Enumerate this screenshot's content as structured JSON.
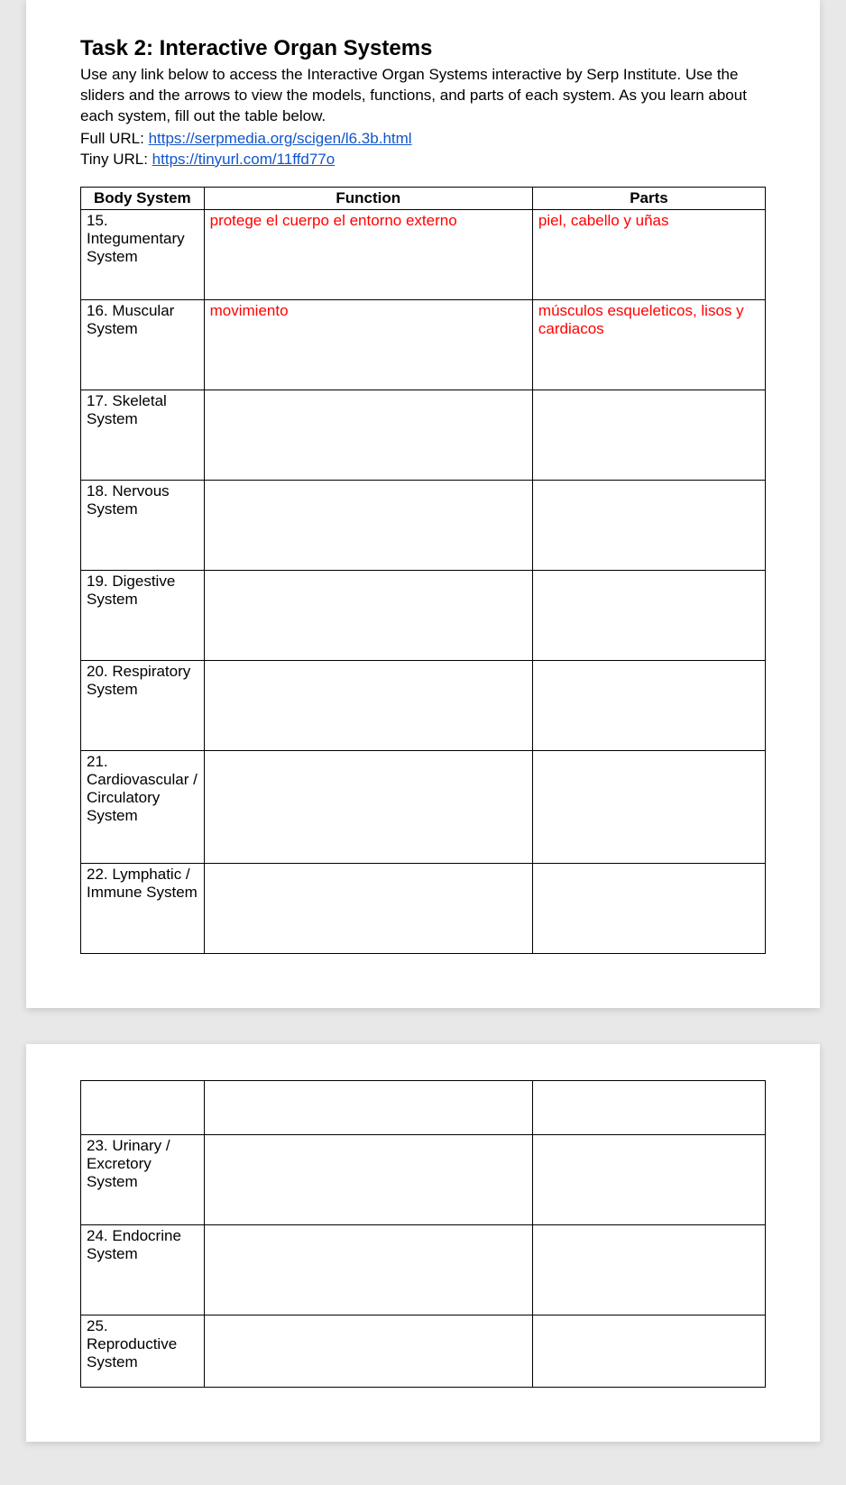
{
  "title": "Task 2: Interactive Organ Systems",
  "intro": "Use any link below to access the Interactive Organ Systems interactive by Serp Institute. Use the sliders and the arrows to view the models, functions, and parts of each system. As you learn about each system, fill out the table below.",
  "full_url_label": "Full URL: ",
  "full_url_text": "https://serpmedia.org/scigen/l6.3b.html",
  "tiny_url_label": "Tiny URL: ",
  "tiny_url_text": "https://tinyurl.com/11ffd77o",
  "headers": {
    "col1": "Body System",
    "col2": "Function",
    "col3": "Parts"
  },
  "rows_page1": [
    {
      "system": "15. Integumentary System",
      "function": "protege el cuerpo el entorno externo",
      "parts": "piel, cabello y uñas"
    },
    {
      "system": "16. Muscular System",
      "function": "movimiento",
      "parts": "músculos esqueleticos, lisos y cardiacos"
    },
    {
      "system": "17. Skeletal System",
      "function": "",
      "parts": ""
    },
    {
      "system": "18. Nervous System",
      "function": "",
      "parts": ""
    },
    {
      "system": "19. Digestive System",
      "function": "",
      "parts": ""
    },
    {
      "system": "20. Respiratory System",
      "function": "",
      "parts": ""
    },
    {
      "system": "21. Cardiovascular / Circulatory System",
      "function": "",
      "parts": ""
    },
    {
      "system": "22. Lymphatic / Immune System",
      "function": "",
      "parts": ""
    }
  ],
  "rows_page2": [
    {
      "system": "",
      "function": "",
      "parts": ""
    },
    {
      "system": "23. Urinary / Excretory System",
      "function": "",
      "parts": ""
    },
    {
      "system": "24. Endocrine System",
      "function": "",
      "parts": ""
    },
    {
      "system": "25. Reproductive System",
      "function": "",
      "parts": ""
    }
  ]
}
